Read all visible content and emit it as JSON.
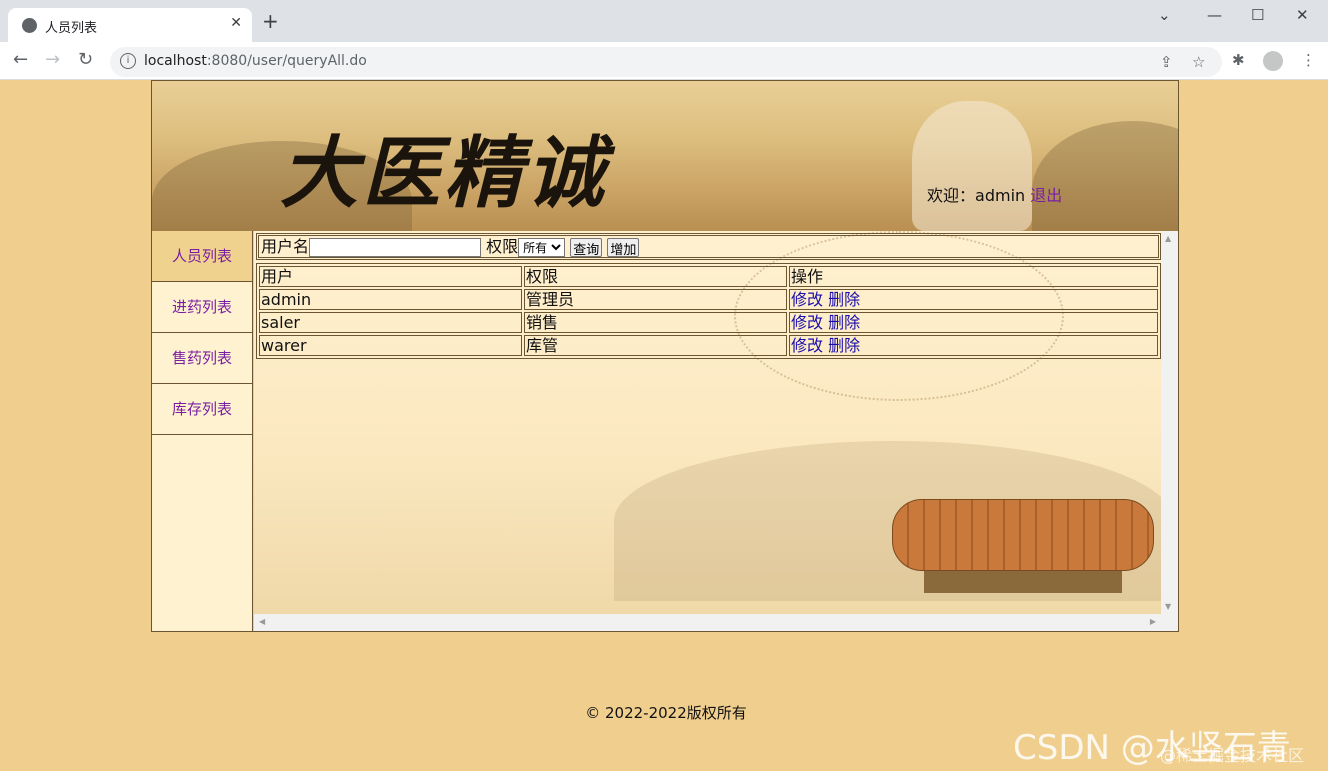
{
  "browser": {
    "tab_title": "人员列表",
    "url_host": "localhost",
    "url_path": ":8080/user/queryAll.do"
  },
  "banner": {
    "logo_text": "大医精诚",
    "welcome_label": "欢迎：",
    "username": "admin",
    "logout_label": "退出"
  },
  "sidebar": {
    "items": [
      {
        "label": "人员列表"
      },
      {
        "label": "进药列表"
      },
      {
        "label": "售药列表"
      },
      {
        "label": "库存列表"
      }
    ]
  },
  "search": {
    "username_label": "用户名",
    "username_value": "",
    "role_label": "权限",
    "role_selected": "所有",
    "query_button": "查询",
    "add_button": "增加"
  },
  "table": {
    "headers": [
      "用户",
      "权限",
      "操作"
    ],
    "rows": [
      {
        "user": "admin",
        "role": "管理员",
        "edit": "修改",
        "delete": "删除"
      },
      {
        "user": "saler",
        "role": "销售",
        "edit": "修改",
        "delete": "删除"
      },
      {
        "user": "warer",
        "role": "库管",
        "edit": "修改",
        "delete": "删除"
      }
    ]
  },
  "footer": {
    "copyright": "© 2022-2022版权所有"
  },
  "watermark": {
    "csdn": "CSDN @水竖石青",
    "juejin": "@稀土掘金技术社区"
  }
}
